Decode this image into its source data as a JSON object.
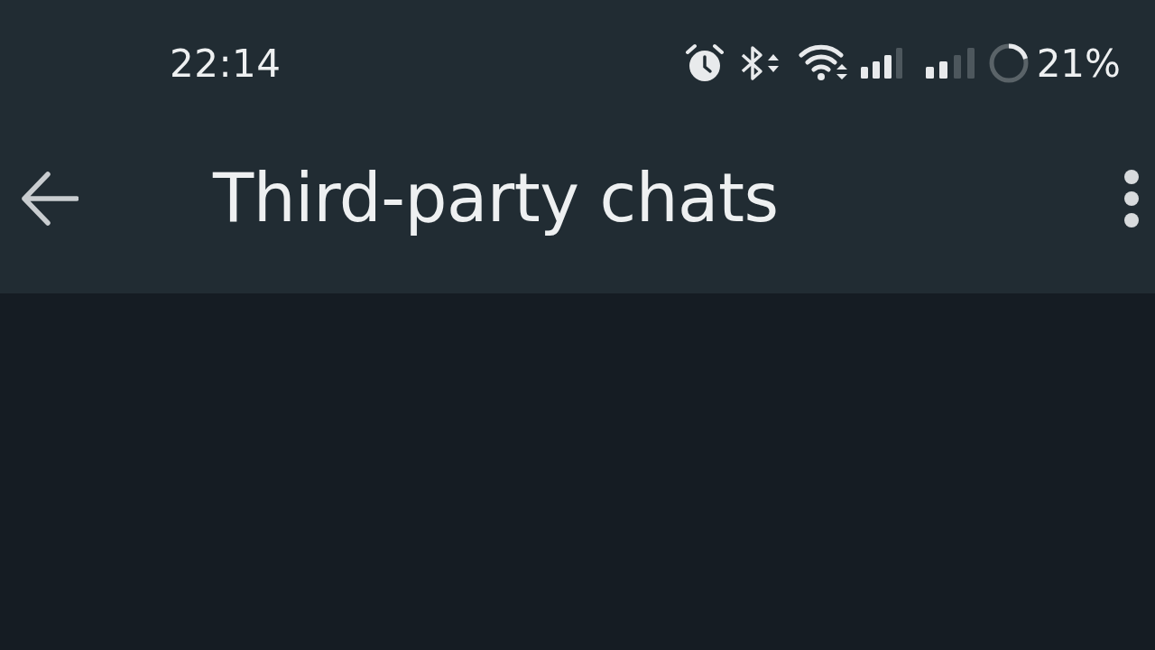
{
  "status_bar": {
    "time": "22:14",
    "battery_percent": "21%"
  },
  "app_bar": {
    "title": "Third-party chats"
  }
}
